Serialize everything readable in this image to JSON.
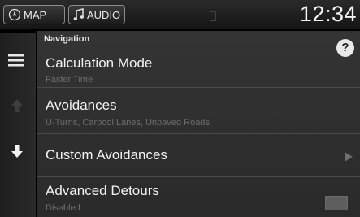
{
  "topbar": {
    "map_label": "MAP",
    "audio_label": "AUDIO",
    "clock": "12:34"
  },
  "sidebar": {
    "icons": [
      "menu-icon",
      "left-arrow-icon",
      "down-arrow-icon"
    ]
  },
  "panel": {
    "section_title": "Navigation",
    "help_label": "?",
    "items": [
      {
        "label": "Calculation Mode",
        "value": "Faster Time"
      },
      {
        "label": "Avoidances",
        "value": "U-Turns, Carpool Lanes, Unpaved Roads"
      },
      {
        "label": "Custom Avoidances"
      },
      {
        "label": "Advanced Detours",
        "value": "Disabled"
      }
    ]
  },
  "colors": {
    "background": "#000000",
    "panel": "#2f2f2f",
    "subtext": "#6d6d6d"
  }
}
